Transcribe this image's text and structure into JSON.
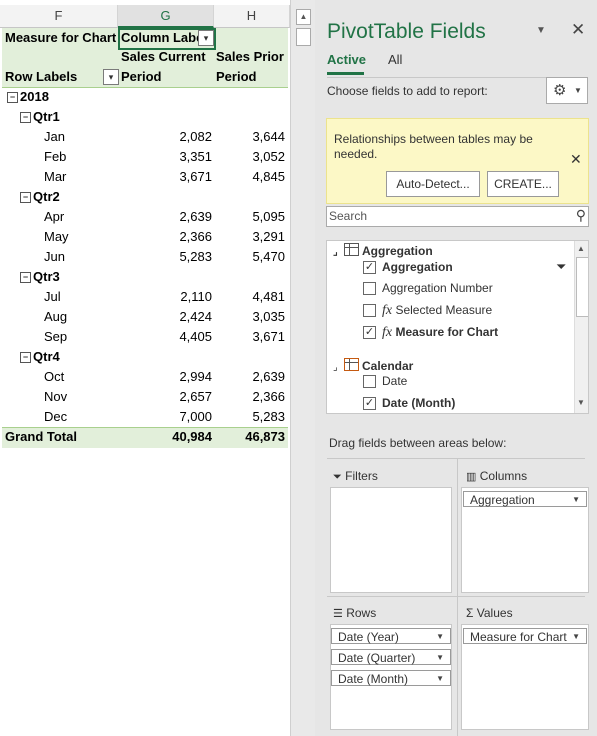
{
  "sheet": {
    "columns": [
      "F",
      "G",
      "H"
    ],
    "header": {
      "measure_label": "Measure for Chart",
      "column_labels": "Column Labels",
      "sales_current_1": "Sales Current",
      "sales_current_2": "Period",
      "sales_prior_1": "Sales Prior",
      "sales_prior_2": "Period",
      "row_labels": "Row Labels"
    },
    "year": "2018",
    "quarters": [
      {
        "label": "Qtr1",
        "months": [
          {
            "m": "Jan",
            "cur": "2,082",
            "prior": "3,644"
          },
          {
            "m": "Feb",
            "cur": "3,351",
            "prior": "3,052"
          },
          {
            "m": "Mar",
            "cur": "3,671",
            "prior": "4,845"
          }
        ]
      },
      {
        "label": "Qtr2",
        "months": [
          {
            "m": "Apr",
            "cur": "2,639",
            "prior": "5,095"
          },
          {
            "m": "May",
            "cur": "2,366",
            "prior": "3,291"
          },
          {
            "m": "Jun",
            "cur": "5,283",
            "prior": "5,470"
          }
        ]
      },
      {
        "label": "Qtr3",
        "months": [
          {
            "m": "Jul",
            "cur": "2,110",
            "prior": "4,481"
          },
          {
            "m": "Aug",
            "cur": "2,424",
            "prior": "3,035"
          },
          {
            "m": "Sep",
            "cur": "4,405",
            "prior": "3,671"
          }
        ]
      },
      {
        "label": "Qtr4",
        "months": [
          {
            "m": "Oct",
            "cur": "2,994",
            "prior": "2,639"
          },
          {
            "m": "Nov",
            "cur": "2,657",
            "prior": "2,366"
          },
          {
            "m": "Dec",
            "cur": "7,000",
            "prior": "5,283"
          }
        ]
      }
    ],
    "grand_total": {
      "label": "Grand Total",
      "cur": "40,984",
      "prior": "46,873"
    }
  },
  "pane": {
    "title": "PivotTable Fields",
    "tabs": [
      "Active",
      "All"
    ],
    "choose_text": "Choose fields to add to report:",
    "banner": {
      "text": "Relationships between tables may be needed.",
      "auto_detect": "Auto-Detect...",
      "create": "CREATE..."
    },
    "search_placeholder": "Search",
    "fields": {
      "aggregation_table": "Aggregation",
      "aggregation": "Aggregation",
      "aggregation_number": "Aggregation Number",
      "selected_measure": "Selected Measure",
      "measure_for_chart": "Measure for Chart",
      "calendar_table": "Calendar",
      "date": "Date",
      "date_month": "Date (Month)"
    },
    "drag_text": "Drag fields between areas below:",
    "areas": {
      "filters": "Filters",
      "columns": "Columns",
      "rows": "Rows",
      "values": "Values",
      "columns_items": [
        "Aggregation"
      ],
      "rows_items": [
        "Date (Year)",
        "Date (Quarter)",
        "Date (Month)"
      ],
      "values_items": [
        "Measure for Chart"
      ]
    }
  },
  "colors": {
    "accent": "#217346",
    "pivot_header_bg": "#e2efda",
    "banner_bg": "#fcf8c6"
  }
}
